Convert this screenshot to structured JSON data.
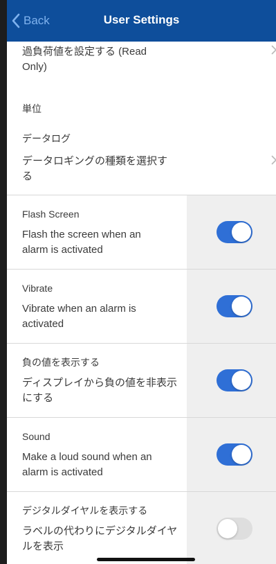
{
  "colors": {
    "nav_bg": "#0e4e9b",
    "toggle_on": "#2f6fd6",
    "toggle_off": "#dedede"
  },
  "nav": {
    "back_label": "Back",
    "title": "User Settings"
  },
  "overload": {
    "label": "過負荷値を設定する (Read Only)"
  },
  "units": {
    "label": "単位"
  },
  "datalog": {
    "title": "データログ",
    "description": "データロギングの種類を選択する"
  },
  "toggles": [
    {
      "title": "Flash Screen",
      "description": "Flash the screen when an alarm is activated",
      "on": true
    },
    {
      "title": "Vibrate",
      "description": "Vibrate when an alarm is activated",
      "on": true
    },
    {
      "title": "負の値を表示する",
      "description": "ディスプレイから負の値を非表示にする",
      "on": true
    },
    {
      "title": "Sound",
      "description": "Make a loud sound when an alarm is activated",
      "on": true
    },
    {
      "title": "デジタルダイヤルを表示する",
      "description": "ラベルの代わりにデジタルダイヤルを表示",
      "on": false
    }
  ]
}
